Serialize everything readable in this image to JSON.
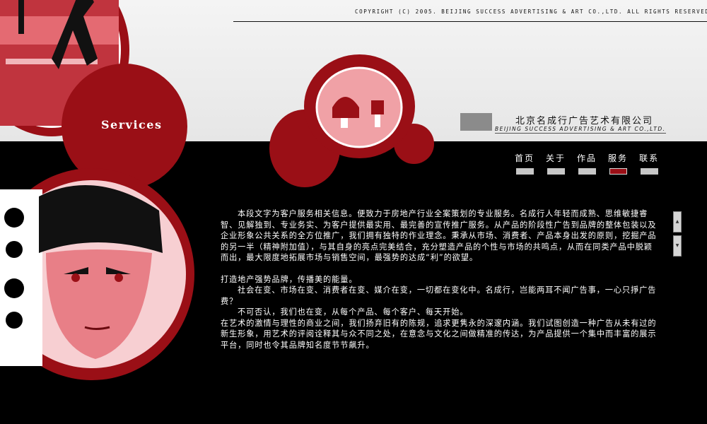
{
  "header": {
    "copyright": "COPYRIGHT (C) 2005. BEIJING SUCCESS ADVERTISING & ART CO.,LTD. ALL RIGHTS RESERVED.",
    "company_cn": "北京名成行广告艺术有限公司",
    "company_en": "BEIJING SUCCESS ADVERTISING & ART CO.,LTD.",
    "section_title": "Services"
  },
  "nav": {
    "items": [
      {
        "label": "首页",
        "active": false
      },
      {
        "label": "关于",
        "active": false
      },
      {
        "label": "作品",
        "active": false
      },
      {
        "label": "服务",
        "active": true
      },
      {
        "label": "联系",
        "active": false
      }
    ]
  },
  "content": {
    "p1": "本段文字为客户服务相关信息。便致力于房地产行业全案策划的专业服务。名成行人年轻而成熟、思维敏捷睿智、见解独到、专业务实、为客户提供最实用、最完善的宣传推广服务。从产品的阶段性广告到品牌的整体包装以及企业形象公共关系的全方位推广，我们拥有独特的作业理念。秉承从市场、消费者、产品本身出发的原则，挖掘产品的另一半（精神附加值），与其自身的亮点完美结合，充分塑造产品的个性与市场的共鸣点，从而在同类产品中脱颖而出，最大限度地拓展市场与销售空间，最强势的达成“利”的欲望。",
    "p2": "打造地产强势品牌，传播美的能量。",
    "p3": "社会在变、市场在变、消费者在变、媒介在变，一切都在变化中。名成行，岂能两耳不闻广告事，一心只掙广告费？",
    "p4": "不可否认，我们也在变，从每个产品、每个客户、每天开始。",
    "p5": "在艺术的激情与理性的商业之间，我们扬弃旧有的陈规，追求更隽永的深邃内涵。我们试图创造一种广告从未有过的新生形象，用艺术的评阅诠释其与众不同之处，在意念与文化之间做精准的传达，为产品提供一个集中而丰富的展示平台，同时也令其品牌知名度节节飙升。"
  },
  "colors": {
    "accent": "#9a0f16",
    "background": "#000000",
    "header": "#ececec"
  }
}
